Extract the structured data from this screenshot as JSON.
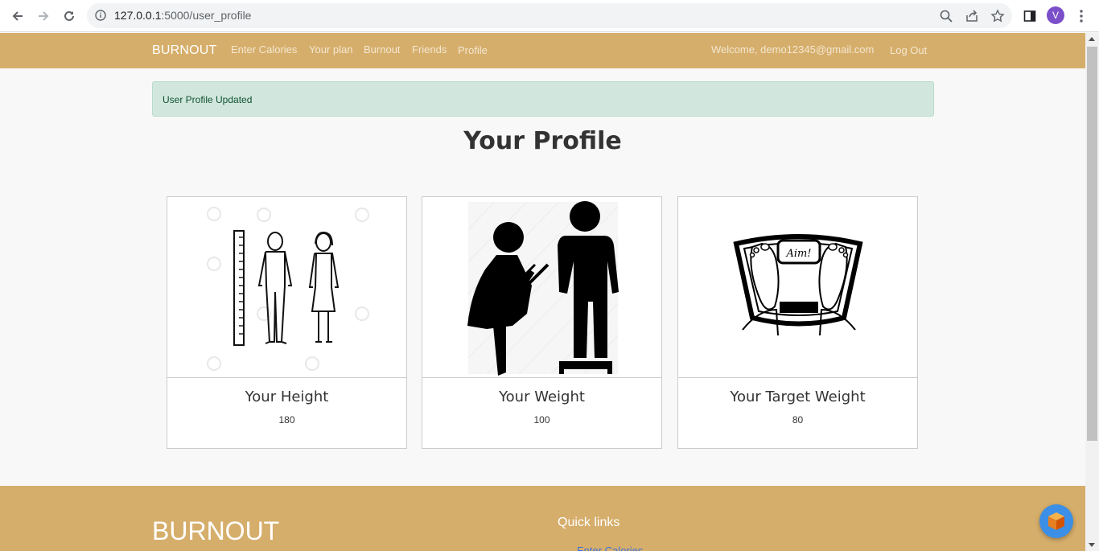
{
  "browser": {
    "url_host": "127.0.0.1",
    "url_path": ":5000/user_profile",
    "avatar_letter": "V"
  },
  "navbar": {
    "brand": "BURNOUT",
    "links": [
      "Enter Calories",
      "Your plan",
      "Burnout",
      "Friends",
      "Profile"
    ],
    "welcome": "Welcome, demo12345@gmail.com",
    "logout": "Log Out"
  },
  "alert": {
    "message": "User Profile Updated"
  },
  "page_title": "Your Profile",
  "cards": [
    {
      "title": "Your Height",
      "value": "180",
      "icon": "height-measure-illustration"
    },
    {
      "title": "Your Weight",
      "value": "100",
      "icon": "weight-measure-illustration"
    },
    {
      "title": "Your Target Weight",
      "value": "80",
      "icon": "scale-aim-illustration"
    }
  ],
  "footer": {
    "brand": "BURNOUT",
    "quick_links_title": "Quick links",
    "first_link": "Enter Calories"
  },
  "colors": {
    "navbar": "#d6ae6b",
    "alert_bg": "#d1e7dd",
    "fab": "#3b8fe6"
  }
}
